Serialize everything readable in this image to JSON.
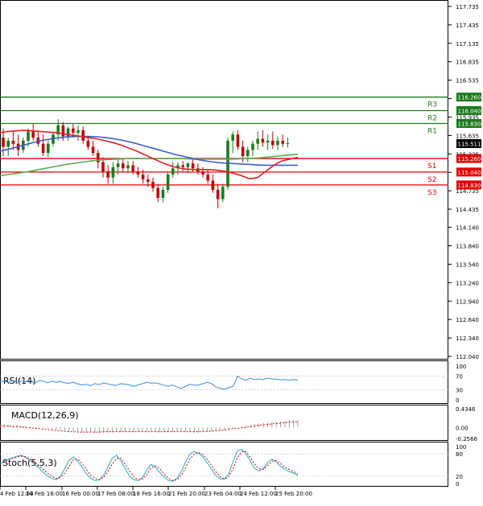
{
  "chart_data": {
    "type": "candlestick",
    "main": {
      "y_ticks": [
        "117.735",
        "117.435",
        "117.135",
        "116.835",
        "116.535",
        "116.235",
        "115.935",
        "115.635",
        "115.335",
        "115.035",
        "114.735",
        "114.435",
        "114.140",
        "113.840",
        "113.540",
        "113.240",
        "112.940",
        "112.640",
        "112.340",
        "112.040"
      ],
      "ylim": [
        112.04,
        117.735
      ],
      "last_price": "115.511",
      "levels": [
        {
          "label": "R3",
          "value": 116.26,
          "tag": "116.260",
          "color": "#1b7a1b"
        },
        {
          "label": "R2",
          "value": 116.04,
          "tag": "116.040",
          "color": "#1b7a1b"
        },
        {
          "label": "R1",
          "value": 115.83,
          "tag": "115.830",
          "color": "#1b7a1b"
        },
        {
          "label": "S1",
          "value": 115.26,
          "tag": "115.260",
          "color": "#e00000"
        },
        {
          "label": "S2",
          "value": 115.04,
          "tag": "115.040",
          "color": "#e00000"
        },
        {
          "label": "S3",
          "value": 114.83,
          "tag": "114.830",
          "color": "#e00000"
        }
      ],
      "candles": [
        [
          115.6,
          115.75,
          115.3,
          115.45
        ],
        [
          115.45,
          115.6,
          115.3,
          115.55
        ],
        [
          115.55,
          115.7,
          115.4,
          115.5
        ],
        [
          115.5,
          115.65,
          115.3,
          115.4
        ],
        [
          115.4,
          115.6,
          115.35,
          115.55
        ],
        [
          115.55,
          115.75,
          115.45,
          115.7
        ],
        [
          115.7,
          115.82,
          115.55,
          115.6
        ],
        [
          115.6,
          115.7,
          115.45,
          115.5
        ],
        [
          115.5,
          115.65,
          115.3,
          115.35
        ],
        [
          115.35,
          115.55,
          115.28,
          115.5
        ],
        [
          115.5,
          115.7,
          115.45,
          115.65
        ],
        [
          115.65,
          115.9,
          115.55,
          115.8
        ],
        [
          115.8,
          115.85,
          115.55,
          115.62
        ],
        [
          115.62,
          115.78,
          115.55,
          115.75
        ],
        [
          115.75,
          115.82,
          115.6,
          115.68
        ],
        [
          115.68,
          115.8,
          115.55,
          115.72
        ],
        [
          115.72,
          115.78,
          115.5,
          115.55
        ],
        [
          115.55,
          115.6,
          115.4,
          115.45
        ],
        [
          115.45,
          115.55,
          115.3,
          115.35
        ],
        [
          115.35,
          115.4,
          115.1,
          115.2
        ],
        [
          115.2,
          115.28,
          114.95,
          115.05
        ],
        [
          115.05,
          115.15,
          114.85,
          114.95
        ],
        [
          114.95,
          115.2,
          114.85,
          115.12
        ],
        [
          115.12,
          115.25,
          115.0,
          115.18
        ],
        [
          115.18,
          115.26,
          115.05,
          115.1
        ],
        [
          115.1,
          115.22,
          115.02,
          115.15
        ],
        [
          115.15,
          115.22,
          115.0,
          115.05
        ],
        [
          115.05,
          115.12,
          114.95,
          115.0
        ],
        [
          115.0,
          115.08,
          114.85,
          114.92
        ],
        [
          114.92,
          115.0,
          114.8,
          114.88
        ],
        [
          114.88,
          114.95,
          114.72,
          114.78
        ],
        [
          114.78,
          114.85,
          114.55,
          114.62
        ],
        [
          114.62,
          114.8,
          114.55,
          114.75
        ],
        [
          114.75,
          115.05,
          114.7,
          115.0
        ],
        [
          115.0,
          115.2,
          114.95,
          115.1
        ],
        [
          115.1,
          115.2,
          115.0,
          115.15
        ],
        [
          115.15,
          115.22,
          115.05,
          115.12
        ],
        [
          115.12,
          115.2,
          115.02,
          115.18
        ],
        [
          115.18,
          115.25,
          115.05,
          115.1
        ],
        [
          115.1,
          115.18,
          115.0,
          115.05
        ],
        [
          115.05,
          115.12,
          114.95,
          115.0
        ],
        [
          115.0,
          115.08,
          114.85,
          114.9
        ],
        [
          114.9,
          115.0,
          114.7,
          114.75
        ],
        [
          114.75,
          114.85,
          114.45,
          114.6
        ],
        [
          114.6,
          114.85,
          114.55,
          114.8
        ],
        [
          114.8,
          115.6,
          114.75,
          115.55
        ],
        [
          115.55,
          115.7,
          115.35,
          115.65
        ],
        [
          115.65,
          115.72,
          115.4,
          115.45
        ],
        [
          115.45,
          115.55,
          115.2,
          115.3
        ],
        [
          115.3,
          115.45,
          115.2,
          115.4
        ],
        [
          115.4,
          115.55,
          115.3,
          115.5
        ],
        [
          115.5,
          115.7,
          115.4,
          115.58
        ],
        [
          115.58,
          115.72,
          115.45,
          115.52
        ],
        [
          115.52,
          115.65,
          115.4,
          115.55
        ],
        [
          115.55,
          115.7,
          115.42,
          115.48
        ],
        [
          115.48,
          115.62,
          115.4,
          115.55
        ],
        [
          115.55,
          115.65,
          115.45,
          115.5
        ],
        [
          115.5,
          115.6,
          115.44,
          115.51
        ]
      ],
      "ma_red": [
        115.68,
        115.7,
        115.71,
        115.72,
        115.71,
        115.7,
        115.69,
        115.68,
        115.66,
        115.64,
        115.62,
        115.6,
        115.58,
        115.55,
        115.52,
        115.48,
        115.43,
        115.38,
        115.32,
        115.26,
        115.2,
        115.15,
        115.11,
        115.09,
        115.08,
        115.08,
        115.08,
        115.07,
        115.05,
        115.02,
        114.98,
        114.93,
        114.95,
        115.05,
        115.15,
        115.22,
        115.25,
        115.28
      ],
      "ma_blue": [
        115.38,
        115.42,
        115.47,
        115.52,
        115.56,
        115.59,
        115.61,
        115.62,
        115.62,
        115.61,
        115.59,
        115.56,
        115.52,
        115.47,
        115.42,
        115.37,
        115.32,
        115.28,
        115.24,
        115.21,
        115.19,
        115.18,
        115.17,
        115.16,
        115.15,
        115.15,
        115.15,
        115.15
      ],
      "ma_green": [
        114.98,
        115.01,
        115.04,
        115.08,
        115.12,
        115.16,
        115.19,
        115.22,
        115.24,
        115.25,
        115.26,
        115.26,
        115.26,
        115.26,
        115.26,
        115.25,
        115.25,
        115.25,
        115.25,
        115.26,
        115.27,
        115.29,
        115.31,
        115.33
      ]
    },
    "x_labels": [
      "4 Feb 12:00",
      "14 Feb 16:00",
      "16 Feb 00:00",
      "17 Feb 08:00",
      "18 Feb 16:00",
      "21 Feb 20:00",
      "23 Feb 04:00",
      "24 Feb 12:00",
      "25 Feb 20:00"
    ],
    "rsi": {
      "label": "RSI(14)",
      "ticks": [
        "100",
        "70",
        "30",
        "0"
      ],
      "ylim": [
        0,
        100
      ],
      "values": [
        52,
        56,
        51,
        58,
        50,
        55,
        54,
        60,
        48,
        57,
        56,
        50,
        55,
        52,
        54,
        50,
        49,
        52,
        47,
        44,
        46,
        42,
        48,
        45,
        50,
        47,
        44,
        43,
        48,
        46,
        44,
        40,
        44,
        48,
        52,
        49,
        50,
        47,
        43,
        40,
        44,
        38,
        34,
        40,
        46,
        43,
        44,
        48,
        52,
        48,
        38,
        34,
        31,
        36,
        40,
        70,
        62,
        58,
        64,
        60,
        62,
        60,
        64,
        62,
        61,
        59,
        60,
        58,
        60,
        58
      ]
    },
    "macd": {
      "label": "MACD(12,26,9)",
      "ticks": [
        "0.4346",
        "0.00",
        "-0.2566"
      ],
      "ylim": [
        -0.2566,
        0.4346
      ],
      "histogram": [
        0.06,
        0.07,
        0.06,
        0.05,
        0.04,
        0.03,
        0.02,
        0.01,
        0.0,
        -0.01,
        -0.02,
        -0.03,
        -0.04,
        -0.05,
        -0.06,
        -0.07,
        -0.08,
        -0.09,
        -0.1,
        -0.11,
        -0.12,
        -0.12,
        -0.13,
        -0.13,
        -0.13,
        -0.12,
        -0.12,
        -0.11,
        -0.11,
        -0.1,
        -0.1,
        -0.1,
        -0.1,
        -0.09,
        -0.09,
        -0.1,
        -0.11,
        -0.12,
        -0.12,
        -0.11,
        -0.1,
        -0.09,
        -0.09,
        -0.1,
        -0.11,
        -0.12,
        -0.12,
        -0.11,
        -0.1,
        -0.09,
        -0.08,
        -0.07,
        -0.06,
        -0.05,
        -0.03,
        0.0,
        0.02,
        0.04,
        0.06,
        0.08,
        0.09,
        0.1,
        0.11,
        0.12,
        0.13,
        0.14,
        0.15,
        0.16,
        0.17,
        0.17
      ],
      "signal": [
        0.03,
        0.03,
        0.03,
        0.02,
        0.02,
        0.01,
        0.0,
        -0.01,
        -0.02,
        -0.03,
        -0.04,
        -0.05,
        -0.06,
        -0.07,
        -0.08,
        -0.09,
        -0.1,
        -0.1,
        -0.11,
        -0.11,
        -0.11,
        -0.11,
        -0.11,
        -0.11,
        -0.1,
        -0.1,
        -0.1,
        -0.1,
        -0.1,
        -0.1,
        -0.1,
        -0.1,
        -0.1,
        -0.1,
        -0.1,
        -0.1,
        -0.1,
        -0.1,
        -0.1,
        -0.1,
        -0.1,
        -0.1,
        -0.1,
        -0.1,
        -0.1,
        -0.1,
        -0.1,
        -0.1,
        -0.09,
        -0.09,
        -0.08,
        -0.07,
        -0.06,
        -0.05,
        -0.03,
        -0.02,
        -0.01,
        0.0,
        0.02,
        0.03,
        0.05,
        0.06,
        0.07,
        0.08,
        0.09,
        0.1,
        0.11,
        0.12,
        0.13,
        0.13
      ]
    },
    "stoch": {
      "label": "Stoch(5,5,3)",
      "ticks": [
        "100",
        "80",
        "20",
        "0"
      ],
      "ylim": [
        0,
        100
      ],
      "main": [
        55,
        60,
        66,
        70,
        74,
        76,
        70,
        62,
        52,
        42,
        30,
        20,
        14,
        10,
        20,
        40,
        62,
        72,
        60,
        44,
        26,
        14,
        8,
        10,
        22,
        44,
        68,
        76,
        62,
        40,
        20,
        10,
        8,
        16,
        36,
        52,
        44,
        30,
        18,
        8,
        6,
        14,
        32,
        58,
        80,
        86,
        82,
        72,
        56,
        38,
        22,
        12,
        12,
        26,
        60,
        88,
        92,
        80,
        60,
        40,
        34,
        40,
        56,
        66,
        58,
        46,
        38,
        32,
        28,
        22
      ],
      "signal": [
        52,
        58,
        63,
        68,
        72,
        74,
        72,
        66,
        58,
        48,
        38,
        28,
        20,
        14,
        16,
        28,
        46,
        64,
        66,
        54,
        38,
        22,
        14,
        10,
        16,
        32,
        52,
        68,
        68,
        52,
        34,
        18,
        10,
        12,
        24,
        42,
        48,
        40,
        26,
        14,
        8,
        10,
        22,
        42,
        66,
        80,
        84,
        78,
        66,
        48,
        32,
        18,
        12,
        18,
        40,
        70,
        86,
        86,
        70,
        52,
        40,
        38,
        48,
        60,
        62,
        54,
        44,
        38,
        32,
        26
      ]
    }
  }
}
